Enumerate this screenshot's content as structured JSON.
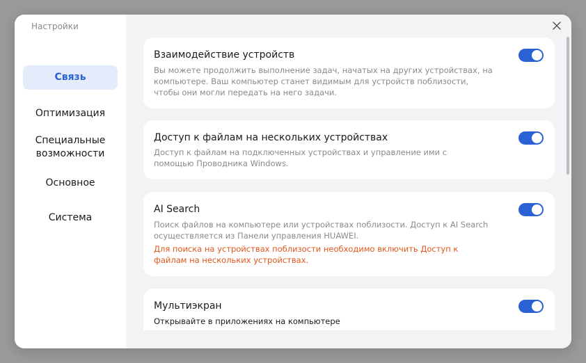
{
  "window": {
    "title": "Настройки",
    "close_icon": "close-icon"
  },
  "sidebar": {
    "items": [
      {
        "label": "Связь",
        "active": true
      },
      {
        "label": "Оптимизация",
        "active": false
      },
      {
        "label": "Специальные возможности",
        "active": false
      },
      {
        "label": "Основное",
        "active": false
      },
      {
        "label": "Система",
        "active": false
      }
    ]
  },
  "cards": [
    {
      "title": "Взаимодействие устройств",
      "description": "Вы можете продолжить выполнение задач, начатых на других устройствах, на компьютере. Ваш компьютер станет видимым для устройств поблизости, чтобы они могли передать на него задачи.",
      "enabled": true
    },
    {
      "title": "Доступ к файлам на нескольких устройствах",
      "description": "Доступ к файлам на подключенных устройствах и управление ими с помощью Проводника Windows.",
      "enabled": true
    },
    {
      "title": "AI Search",
      "description": "Поиск файлов на компьютере или устройствах поблизости. Доступ к AI Search осуществляется из Панели управления HUAWEI.",
      "warning": "Для поиска на устройствах поблизости необходимо включить Доступ к файлам на нескольких устройствах.",
      "enabled": true
    },
    {
      "title": "Мультиэкран",
      "description": "Открывайте в приложениях на компьютере",
      "enabled": true
    }
  ],
  "colors": {
    "accent": "#2a62d6",
    "warning": "#e0561b",
    "background": "#f1f3f5",
    "active_nav_bg": "#e4ecfb"
  }
}
